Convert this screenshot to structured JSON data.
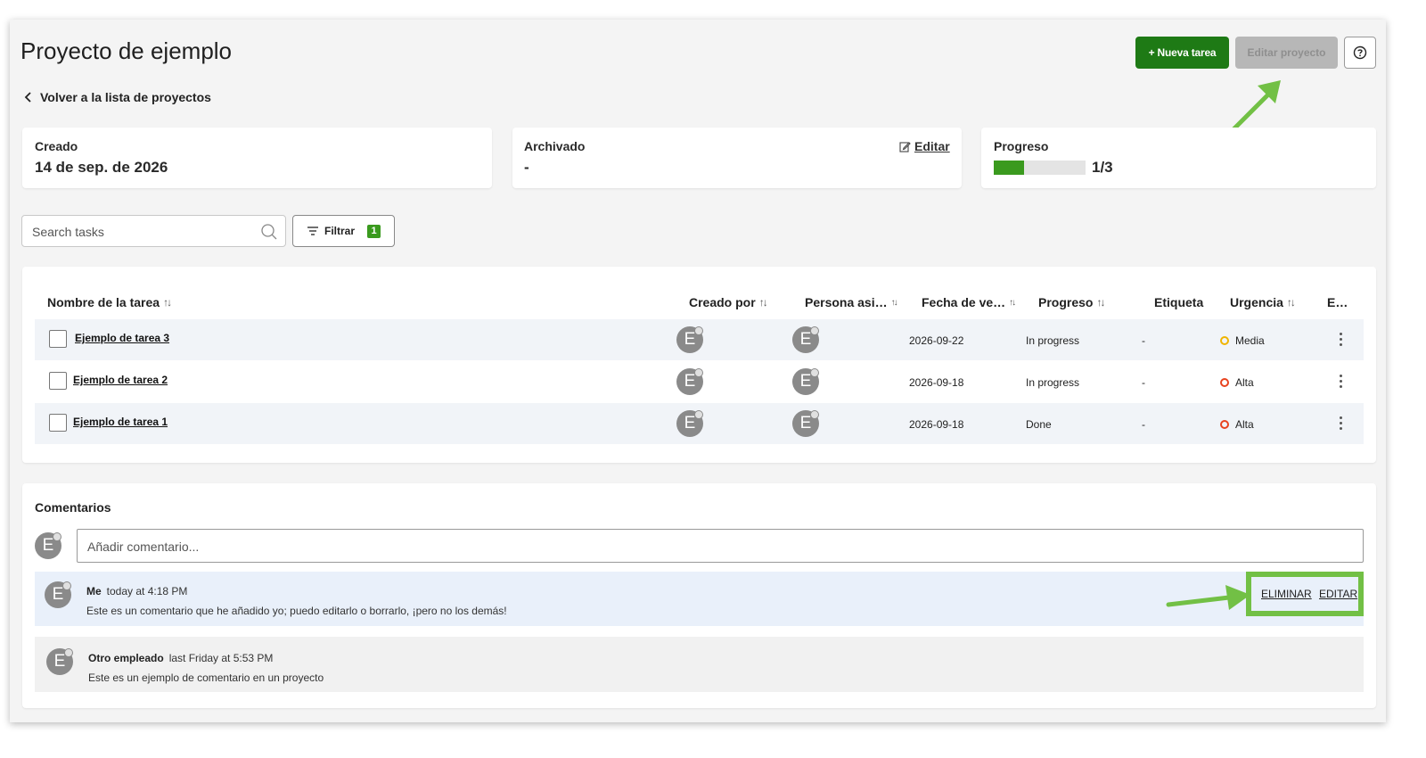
{
  "header": {
    "title": "Proyecto de ejemplo",
    "back_label": "Volver a la lista de proyectos",
    "new_task_label": "+ Nueva tarea",
    "edit_project_label": "Editar proyecto",
    "help_icon": "question-circle-icon"
  },
  "info_cards": {
    "created": {
      "label": "Creado",
      "value": "14 de sep. de 2026"
    },
    "archived": {
      "label": "Archivado",
      "value": "-",
      "edit_label": "Editar"
    },
    "progress": {
      "label": "Progreso",
      "value": "1/3",
      "fraction": 0.333
    }
  },
  "toolbar": {
    "search_placeholder": "Search tasks",
    "filter_label": "Filtrar",
    "filter_count": "1"
  },
  "table": {
    "columns": {
      "name": "Nombre de la tarea",
      "created_by": "Creado por",
      "assignee": "Persona asi…",
      "due_date": "Fecha de ve…",
      "progress": "Progreso",
      "tag": "Etiqueta",
      "urgency": "Urgencia",
      "extra": "E…"
    },
    "rows": [
      {
        "name": "Ejemplo de tarea 3",
        "created_by": "E",
        "assignee": "E",
        "due_date": "2026-09-22",
        "progress": "In progress",
        "tag": "-",
        "urgency": "Media",
        "urgency_color": "#f0b400"
      },
      {
        "name": "Ejemplo de tarea 2",
        "created_by": "E",
        "assignee": "E",
        "due_date": "2026-09-18",
        "progress": "In progress",
        "tag": "-",
        "urgency": "Alta",
        "urgency_color": "#e8431f"
      },
      {
        "name": "Ejemplo de tarea 1",
        "created_by": "E",
        "assignee": "E",
        "due_date": "2026-09-18",
        "progress": "Done",
        "tag": "-",
        "urgency": "Alta",
        "urgency_color": "#e8431f"
      }
    ]
  },
  "comments": {
    "title": "Comentarios",
    "input_placeholder": "Añadir comentario...",
    "avatar_letter": "E",
    "items": [
      {
        "avatar": "E",
        "author": "Me",
        "time": "today at 4:18 PM",
        "text": "Este es un comentario que he añadido yo; puedo editarlo o borrarlo, ¡pero no los demás!",
        "delete_label": "ELIMINAR",
        "edit_label": "EDITAR"
      },
      {
        "avatar": "E",
        "author": "Otro empleado",
        "time": "last Friday at 5:53 PM",
        "text": "Este es un ejemplo de comentario en un proyecto"
      }
    ]
  },
  "colors": {
    "primary_green": "#1e7a15",
    "progress_fill": "#3a9a1e",
    "annotation_green": "#72c045"
  }
}
